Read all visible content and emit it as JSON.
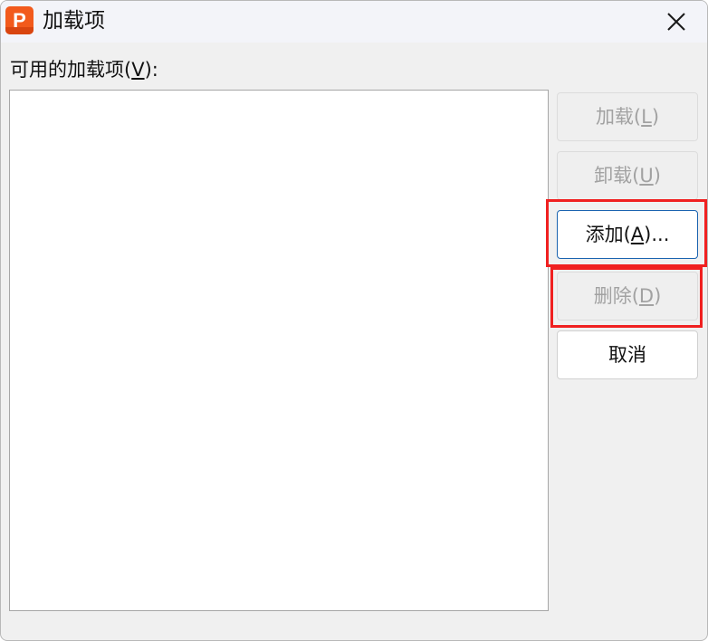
{
  "window": {
    "title": "加载项",
    "app_icon_letter": "P",
    "close_glyph": "✕"
  },
  "available_label": {
    "prefix": "可用的加载项(",
    "mnemonic": "V",
    "suffix": "):"
  },
  "addins_list": [],
  "buttons": {
    "load": {
      "prefix": "加载(",
      "mnemonic": "L",
      "suffix": ")",
      "enabled": false
    },
    "unload": {
      "prefix": "卸载(",
      "mnemonic": "U",
      "suffix": ")",
      "enabled": false
    },
    "add": {
      "prefix": "添加(",
      "mnemonic": "A",
      "suffix": ")...",
      "enabled": true,
      "focused": true
    },
    "delete": {
      "prefix": "删除(",
      "mnemonic": "D",
      "suffix": ")",
      "enabled": false
    },
    "cancel": {
      "label": "取消",
      "enabled": true
    }
  },
  "colors": {
    "app_icon": "#f25a1c",
    "highlight_box": "#f02020",
    "focus_border": "#1a63b0",
    "disabled_text": "#a2a2a2"
  }
}
